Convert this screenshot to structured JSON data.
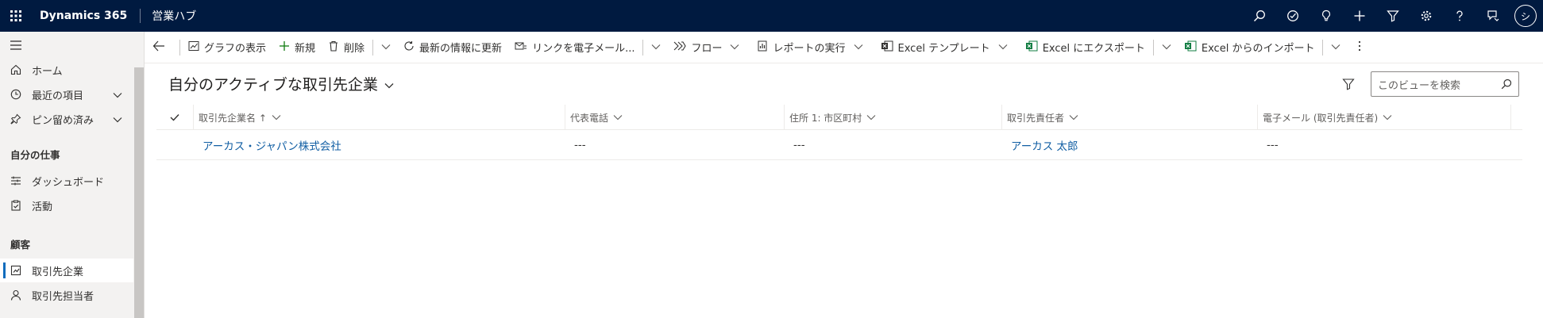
{
  "topbar": {
    "brand": "Dynamics 365",
    "app_title": "営業ハブ",
    "avatar_initial": "シ"
  },
  "sidebar": {
    "home": "ホーム",
    "recent": "最近の項目",
    "pinned": "ピン留め済み",
    "section_my_work": "自分の仕事",
    "dashboards": "ダッシュボード",
    "activities": "活動",
    "section_customers": "顧客",
    "accounts": "取引先企業",
    "contacts": "取引先担当者"
  },
  "commandbar": {
    "chart": "グラフの表示",
    "new": "新規",
    "delete": "削除",
    "refresh": "最新の情報に更新",
    "email_link": "リンクを電子メール...",
    "flow": "フロー",
    "run_report": "レポートの実行",
    "excel_template": "Excel テンプレート",
    "export_excel": "Excel にエクスポート",
    "import_excel": "Excel からのインポート"
  },
  "view": {
    "title": "自分のアクティブな取引先企業",
    "search_placeholder": "このビューを検索"
  },
  "grid": {
    "columns": [
      "取引先企業名 ↑",
      "代表電話",
      "住所 1: 市区町村",
      "取引先責任者",
      "電子メール (取引先責任者)"
    ],
    "rows": [
      {
        "name": "アーカス・ジャパン株式会社",
        "phone": "---",
        "city": "---",
        "primary_contact": "アーカス 太郎",
        "email": "---"
      }
    ]
  },
  "colors": {
    "topbar": "#001a40",
    "accent": "#0f6cbd",
    "excel_green": "#107c41"
  }
}
